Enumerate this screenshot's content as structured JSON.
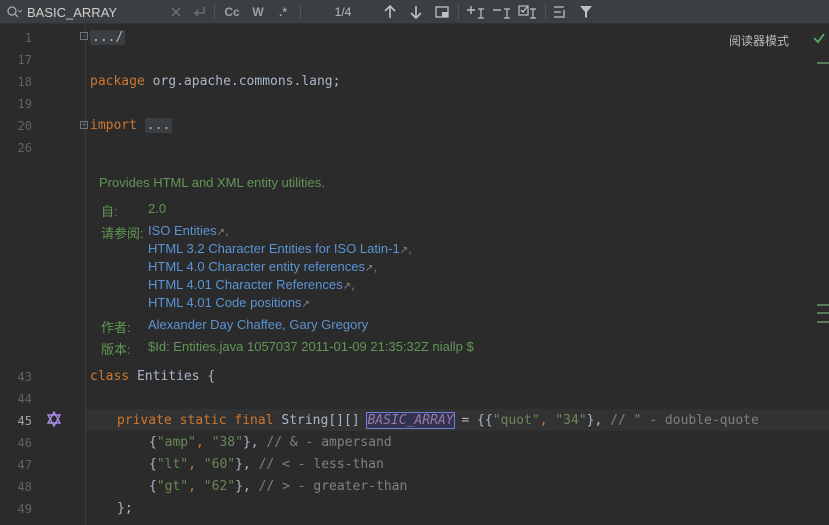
{
  "search": {
    "query": "BASIC_ARRAY",
    "match_case": "Cc",
    "words": "W",
    "regex": ".*",
    "counter": "1/4"
  },
  "editor": {
    "reader_mode": "阅读器模式",
    "lines": {
      "l1": "1",
      "l17": "17",
      "l18": "18",
      "l19": "19",
      "l20": "20",
      "l26": "26",
      "l43": "43",
      "l44": "44",
      "l45": "45",
      "l46": "46",
      "l47": "47",
      "l48": "48",
      "l49": "49"
    },
    "code": {
      "fold1": ".../",
      "package_kw": "package",
      "package_name": " org.apache.commons.lang;",
      "import_kw": "import",
      "import_fold": "...",
      "class_kw": "class",
      "class_name": " Entities {",
      "line45_kw": "private static final",
      "line45_type": " String[][] ",
      "line45_field": "BASIC_ARRAY",
      "line45_rest": " = {{",
      "line45_s1": "\"quot\"",
      "line45_c": ", ",
      "line45_s2": "\"34\"",
      "line45_end": "}, ",
      "line45_comment": "// \" - double-quote",
      "line46_open": "{",
      "line46_s1": "\"amp\"",
      "line46_c": ", ",
      "line46_s2": "\"38\"",
      "line46_end": "}, ",
      "line46_comment": "// & - ampersand",
      "line47_open": "{",
      "line47_s1": "\"lt\"",
      "line47_c": ", ",
      "line47_s2": "\"60\"",
      "line47_end": "}, ",
      "line47_comment": "// < - less-than",
      "line48_open": "{",
      "line48_s1": "\"gt\"",
      "line48_c": ", ",
      "line48_s2": "\"62\"",
      "line48_end": "}, ",
      "line48_comment": "// > - greater-than",
      "line49": "};"
    },
    "doc": {
      "summary": "Provides HTML and XML entity utilities.",
      "since_label": "自:",
      "since_value": "2.0",
      "see_label": "请参阅:",
      "see_links": [
        "ISO Entities",
        "HTML 3.2 Character Entities for ISO Latin-1",
        "HTML 4.0 Character entity references",
        "HTML 4.01 Character References",
        "HTML 4.01 Code positions"
      ],
      "author_label": "作者:",
      "author_value": "Alexander Day Chaffee, Gary Gregory",
      "version_label": "版本:",
      "version_value": "$Id: Entities.java 1057037 2011-01-09 21:35:32Z niallp $"
    }
  },
  "colors": {
    "keyword": "#cc7832",
    "string": "#6a8759",
    "comment": "#808080",
    "doc": "#629755",
    "link": "#5b94d4",
    "field": "#9876aa"
  }
}
